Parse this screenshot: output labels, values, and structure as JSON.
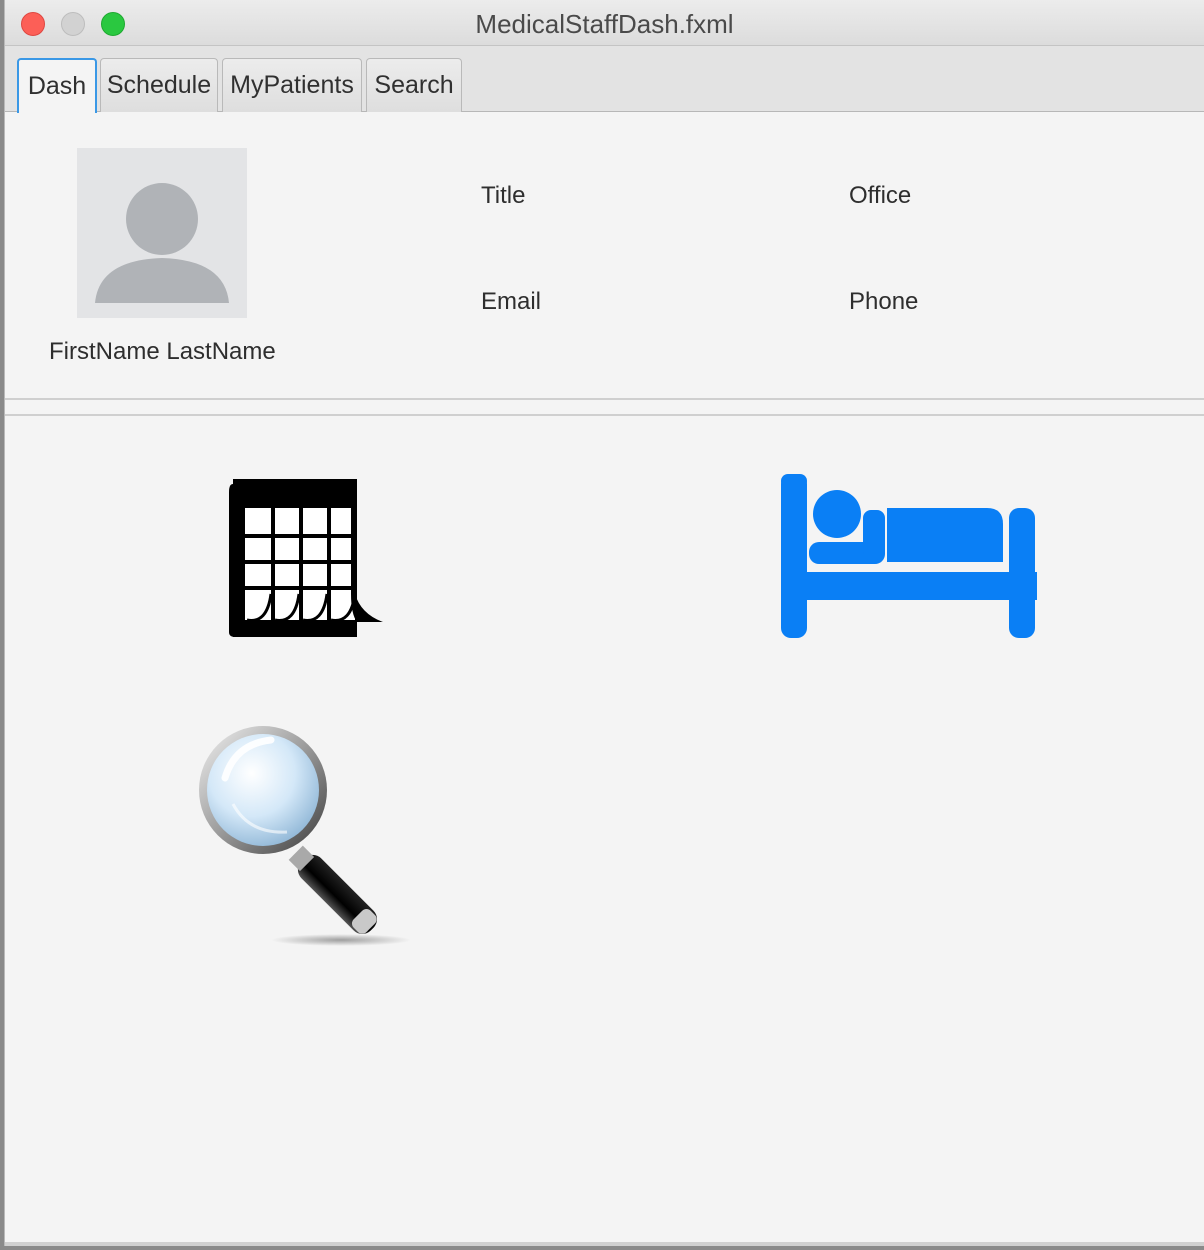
{
  "window": {
    "title": "MedicalStaffDash.fxml"
  },
  "tabs": [
    {
      "label": "Dash",
      "active": true
    },
    {
      "label": "Schedule",
      "active": false
    },
    {
      "label": "MyPatients",
      "active": false
    },
    {
      "label": "Search",
      "active": false
    }
  ],
  "profile": {
    "name": "FirstName LastName",
    "title_label": "Title",
    "office_label": "Office",
    "email_label": "Email",
    "phone_label": "Phone"
  },
  "dashboard": {
    "icons": [
      "calendar-icon",
      "bed-icon",
      "magnifier-icon"
    ],
    "bed_icon_color": "#0a7ff5"
  }
}
